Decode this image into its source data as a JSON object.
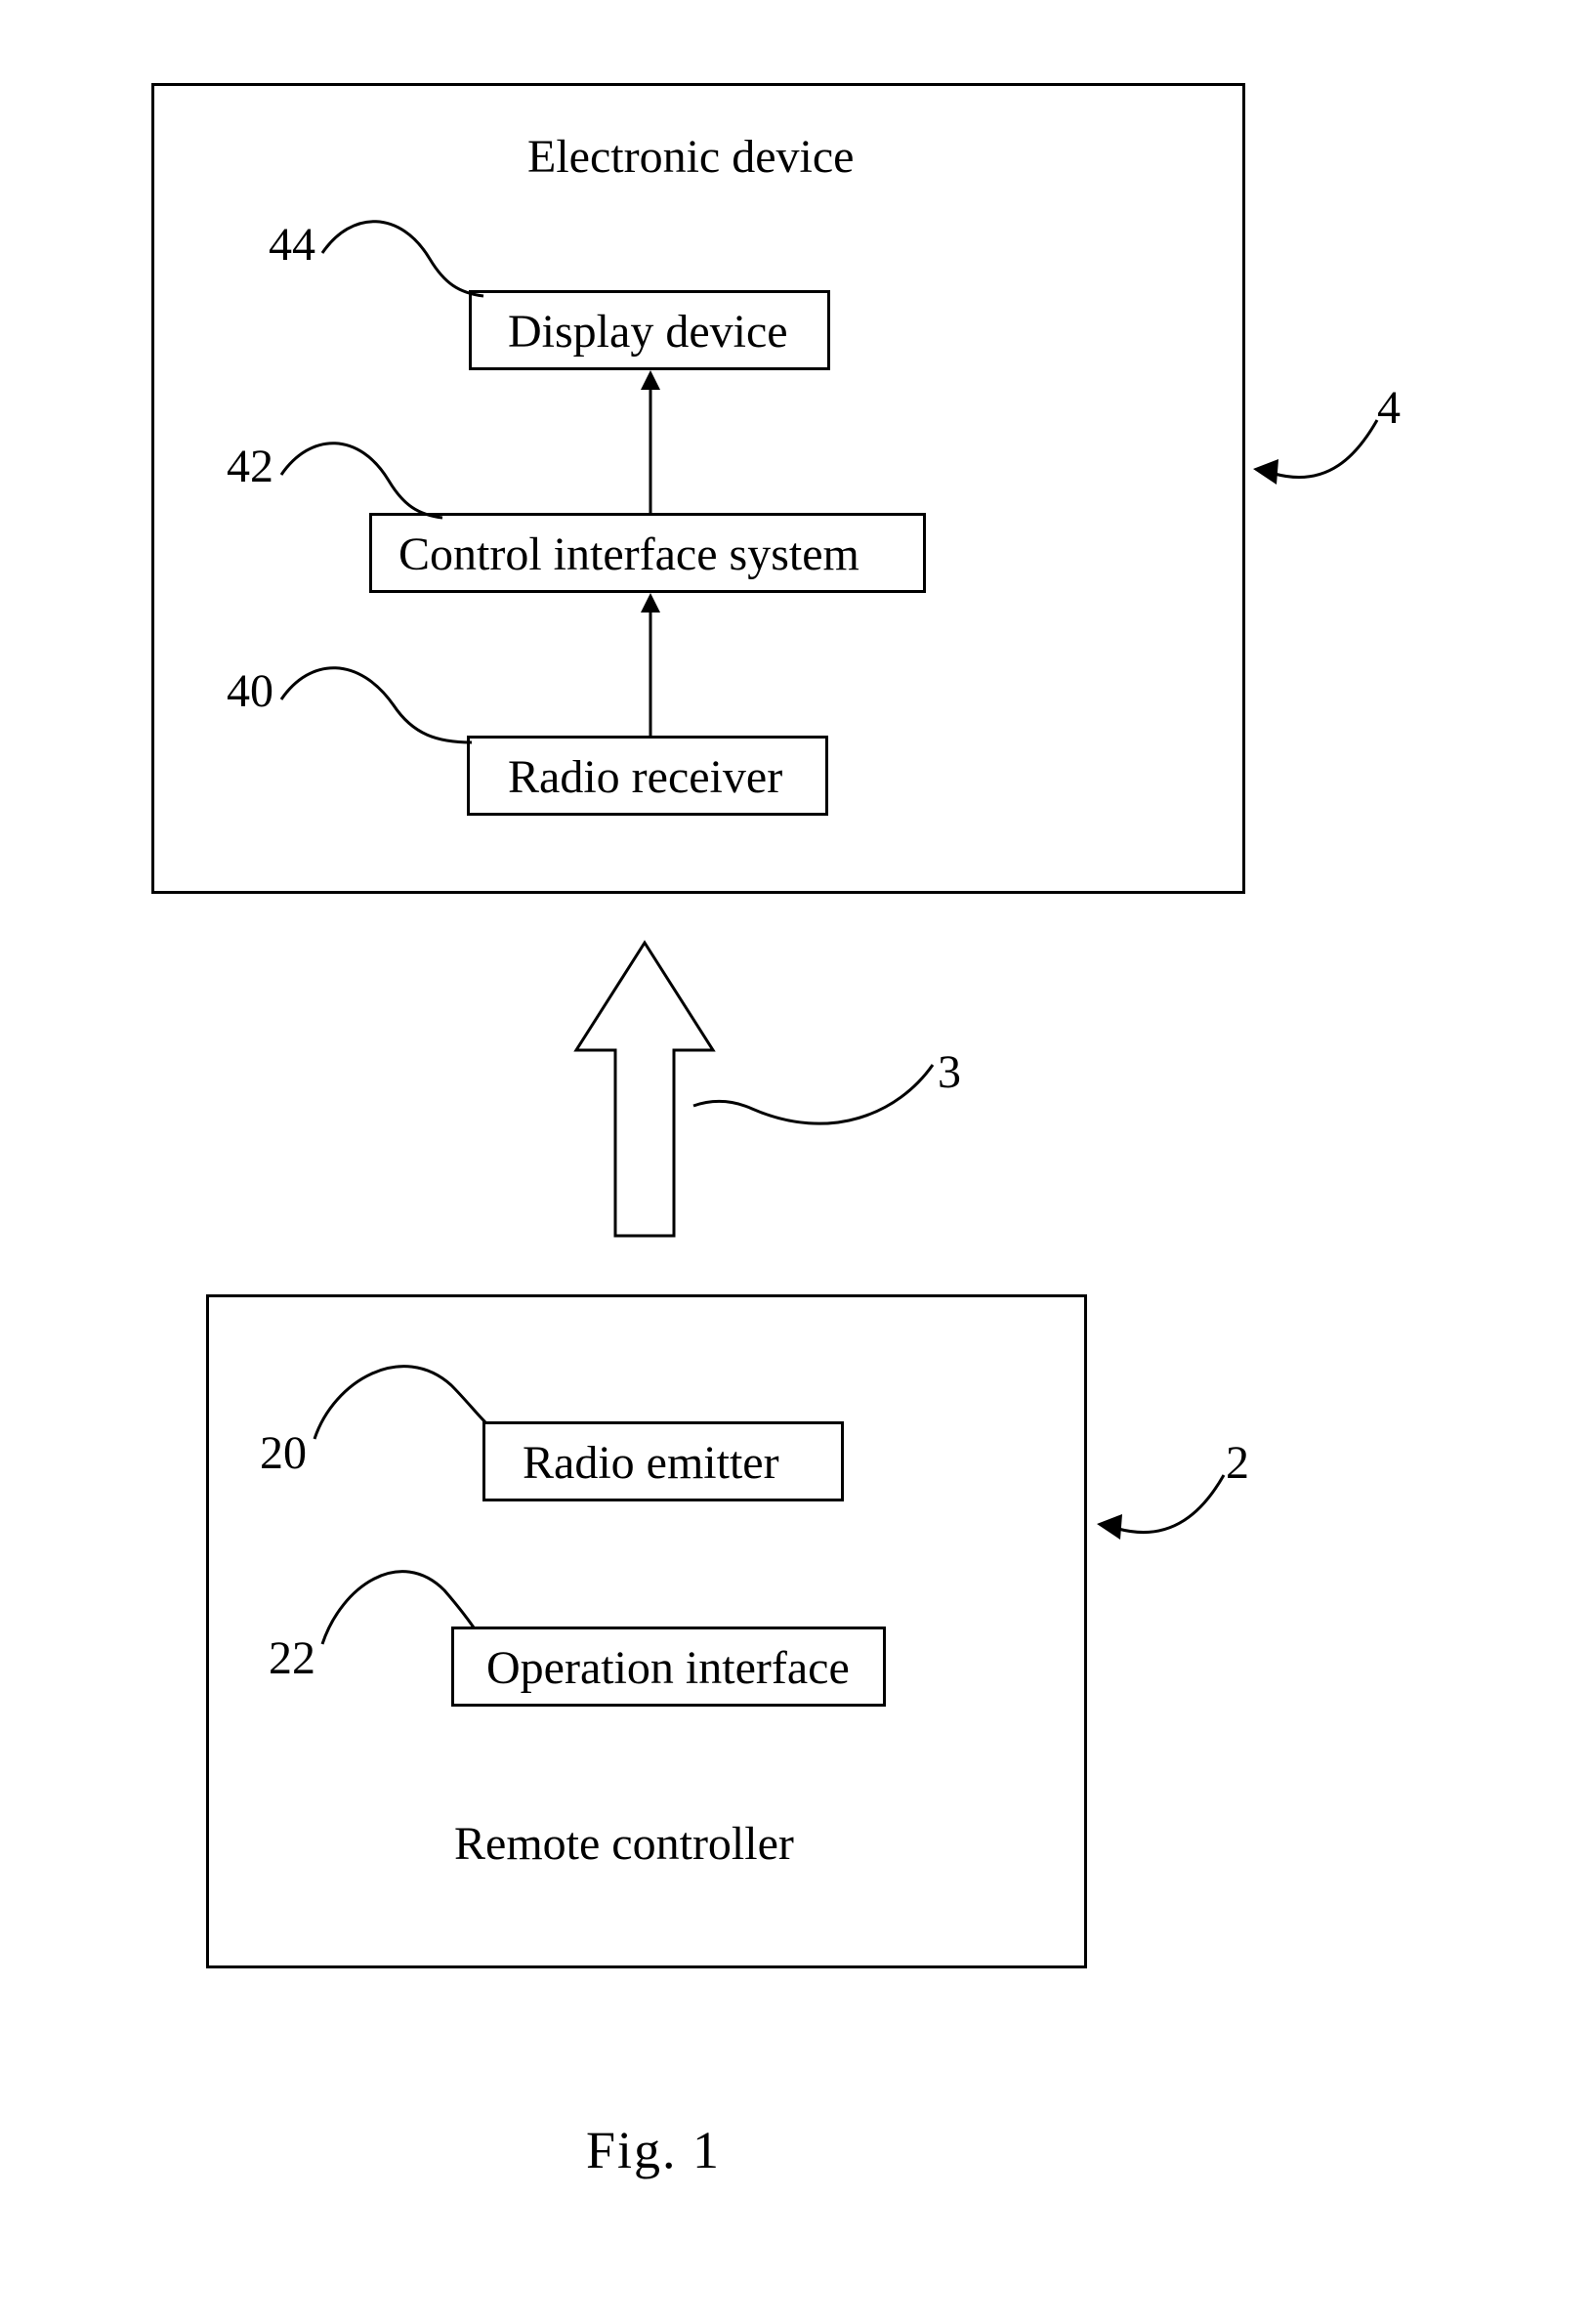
{
  "figure": {
    "caption": "Fig. 1",
    "electronic_device": {
      "title": "Electronic device",
      "ref": "4",
      "display_device": {
        "label": "Display device",
        "ref": "44"
      },
      "control_interface_system": {
        "label": "Control interface system",
        "ref": "42"
      },
      "radio_receiver": {
        "label": "Radio receiver",
        "ref": "40"
      }
    },
    "signal": {
      "ref": "3"
    },
    "remote_controller": {
      "title": "Remote controller",
      "ref": "2",
      "radio_emitter": {
        "label": "Radio emitter",
        "ref": "20"
      },
      "operation_interface": {
        "label": "Operation interface",
        "ref": "22"
      }
    }
  }
}
